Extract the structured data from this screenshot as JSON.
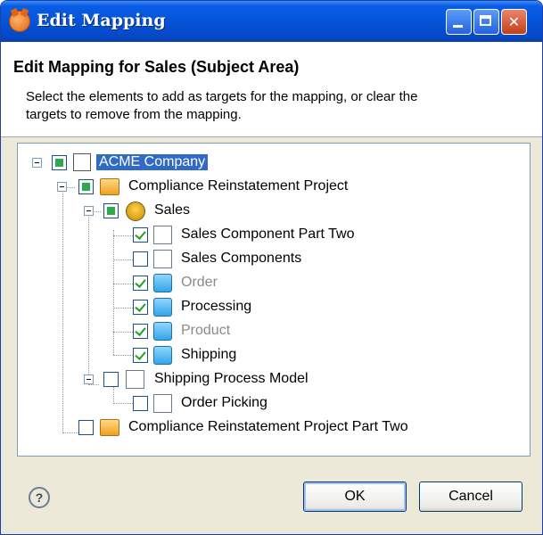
{
  "window": {
    "title": "Edit Mapping",
    "controls": [
      "minimize-icon",
      "maximize-icon",
      "close-icon"
    ]
  },
  "header": {
    "title": "Edit Mapping for Sales (Subject Area)",
    "description": "Select the elements to add as targets for the mapping, or clear the targets to remove from the mapping."
  },
  "tree": {
    "items": [
      {
        "label": "ACME Company",
        "state": "partial",
        "icon": "company-icon",
        "selected": true
      },
      {
        "label": "Compliance Reinstatement Project",
        "state": "partial",
        "icon": "folder-icon"
      },
      {
        "label": "Sales",
        "state": "partial",
        "icon": "subject-area-icon"
      },
      {
        "label": "Sales Component Part Two",
        "state": "checked",
        "icon": "component-icon"
      },
      {
        "label": "Sales Components",
        "state": "unchecked",
        "icon": "component-icon"
      },
      {
        "label": "Order",
        "state": "checked",
        "icon": "entity-icon",
        "greyed": true
      },
      {
        "label": "Processing",
        "state": "checked",
        "icon": "entity-icon"
      },
      {
        "label": "Product",
        "state": "checked",
        "icon": "entity-icon",
        "greyed": true
      },
      {
        "label": "Shipping",
        "state": "checked",
        "icon": "entity-icon"
      },
      {
        "label": "Shipping Process Model",
        "state": "unchecked",
        "icon": "process-model-icon"
      },
      {
        "label": "Order Picking",
        "state": "unchecked",
        "icon": "process-icon"
      },
      {
        "label": "Compliance Reinstatement Project Part Two",
        "state": "unchecked",
        "icon": "folder-icon"
      }
    ]
  },
  "footer": {
    "help_label": "?",
    "ok_label": "OK",
    "cancel_label": "Cancel"
  },
  "colors": {
    "titlebar": "#0553d8",
    "selection": "#316ac5",
    "check": "#21a121"
  }
}
